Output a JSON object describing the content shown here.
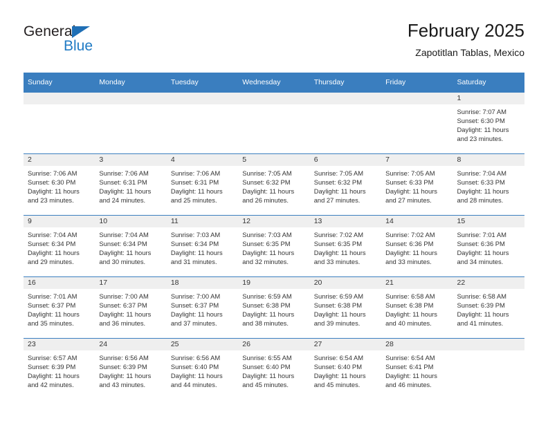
{
  "brand": {
    "name_part1": "General",
    "name_part2": "Blue",
    "triangle_color": "#1f6fb5",
    "blue_color": "#1f7ac4"
  },
  "header": {
    "title": "February 2025",
    "subtitle": "Zapotitlan Tablas, Mexico"
  },
  "theme": {
    "header_bg": "#3a7ebf",
    "daynum_bg": "#efefef",
    "row_border": "#3a7ebf"
  },
  "weekdays": [
    "Sunday",
    "Monday",
    "Tuesday",
    "Wednesday",
    "Thursday",
    "Friday",
    "Saturday"
  ],
  "weeks": [
    [
      {
        "day": "",
        "empty": true,
        "sunrise": "",
        "sunset": "",
        "daylight1": "",
        "daylight2": ""
      },
      {
        "day": "",
        "empty": true,
        "sunrise": "",
        "sunset": "",
        "daylight1": "",
        "daylight2": ""
      },
      {
        "day": "",
        "empty": true,
        "sunrise": "",
        "sunset": "",
        "daylight1": "",
        "daylight2": ""
      },
      {
        "day": "",
        "empty": true,
        "sunrise": "",
        "sunset": "",
        "daylight1": "",
        "daylight2": ""
      },
      {
        "day": "",
        "empty": true,
        "sunrise": "",
        "sunset": "",
        "daylight1": "",
        "daylight2": ""
      },
      {
        "day": "",
        "empty": true,
        "sunrise": "",
        "sunset": "",
        "daylight1": "",
        "daylight2": ""
      },
      {
        "day": "1",
        "empty": false,
        "sunrise": "Sunrise: 7:07 AM",
        "sunset": "Sunset: 6:30 PM",
        "daylight1": "Daylight: 11 hours",
        "daylight2": "and 23 minutes."
      }
    ],
    [
      {
        "day": "2",
        "empty": false,
        "sunrise": "Sunrise: 7:06 AM",
        "sunset": "Sunset: 6:30 PM",
        "daylight1": "Daylight: 11 hours",
        "daylight2": "and 23 minutes."
      },
      {
        "day": "3",
        "empty": false,
        "sunrise": "Sunrise: 7:06 AM",
        "sunset": "Sunset: 6:31 PM",
        "daylight1": "Daylight: 11 hours",
        "daylight2": "and 24 minutes."
      },
      {
        "day": "4",
        "empty": false,
        "sunrise": "Sunrise: 7:06 AM",
        "sunset": "Sunset: 6:31 PM",
        "daylight1": "Daylight: 11 hours",
        "daylight2": "and 25 minutes."
      },
      {
        "day": "5",
        "empty": false,
        "sunrise": "Sunrise: 7:05 AM",
        "sunset": "Sunset: 6:32 PM",
        "daylight1": "Daylight: 11 hours",
        "daylight2": "and 26 minutes."
      },
      {
        "day": "6",
        "empty": false,
        "sunrise": "Sunrise: 7:05 AM",
        "sunset": "Sunset: 6:32 PM",
        "daylight1": "Daylight: 11 hours",
        "daylight2": "and 27 minutes."
      },
      {
        "day": "7",
        "empty": false,
        "sunrise": "Sunrise: 7:05 AM",
        "sunset": "Sunset: 6:33 PM",
        "daylight1": "Daylight: 11 hours",
        "daylight2": "and 27 minutes."
      },
      {
        "day": "8",
        "empty": false,
        "sunrise": "Sunrise: 7:04 AM",
        "sunset": "Sunset: 6:33 PM",
        "daylight1": "Daylight: 11 hours",
        "daylight2": "and 28 minutes."
      }
    ],
    [
      {
        "day": "9",
        "empty": false,
        "sunrise": "Sunrise: 7:04 AM",
        "sunset": "Sunset: 6:34 PM",
        "daylight1": "Daylight: 11 hours",
        "daylight2": "and 29 minutes."
      },
      {
        "day": "10",
        "empty": false,
        "sunrise": "Sunrise: 7:04 AM",
        "sunset": "Sunset: 6:34 PM",
        "daylight1": "Daylight: 11 hours",
        "daylight2": "and 30 minutes."
      },
      {
        "day": "11",
        "empty": false,
        "sunrise": "Sunrise: 7:03 AM",
        "sunset": "Sunset: 6:34 PM",
        "daylight1": "Daylight: 11 hours",
        "daylight2": "and 31 minutes."
      },
      {
        "day": "12",
        "empty": false,
        "sunrise": "Sunrise: 7:03 AM",
        "sunset": "Sunset: 6:35 PM",
        "daylight1": "Daylight: 11 hours",
        "daylight2": "and 32 minutes."
      },
      {
        "day": "13",
        "empty": false,
        "sunrise": "Sunrise: 7:02 AM",
        "sunset": "Sunset: 6:35 PM",
        "daylight1": "Daylight: 11 hours",
        "daylight2": "and 33 minutes."
      },
      {
        "day": "14",
        "empty": false,
        "sunrise": "Sunrise: 7:02 AM",
        "sunset": "Sunset: 6:36 PM",
        "daylight1": "Daylight: 11 hours",
        "daylight2": "and 33 minutes."
      },
      {
        "day": "15",
        "empty": false,
        "sunrise": "Sunrise: 7:01 AM",
        "sunset": "Sunset: 6:36 PM",
        "daylight1": "Daylight: 11 hours",
        "daylight2": "and 34 minutes."
      }
    ],
    [
      {
        "day": "16",
        "empty": false,
        "sunrise": "Sunrise: 7:01 AM",
        "sunset": "Sunset: 6:37 PM",
        "daylight1": "Daylight: 11 hours",
        "daylight2": "and 35 minutes."
      },
      {
        "day": "17",
        "empty": false,
        "sunrise": "Sunrise: 7:00 AM",
        "sunset": "Sunset: 6:37 PM",
        "daylight1": "Daylight: 11 hours",
        "daylight2": "and 36 minutes."
      },
      {
        "day": "18",
        "empty": false,
        "sunrise": "Sunrise: 7:00 AM",
        "sunset": "Sunset: 6:37 PM",
        "daylight1": "Daylight: 11 hours",
        "daylight2": "and 37 minutes."
      },
      {
        "day": "19",
        "empty": false,
        "sunrise": "Sunrise: 6:59 AM",
        "sunset": "Sunset: 6:38 PM",
        "daylight1": "Daylight: 11 hours",
        "daylight2": "and 38 minutes."
      },
      {
        "day": "20",
        "empty": false,
        "sunrise": "Sunrise: 6:59 AM",
        "sunset": "Sunset: 6:38 PM",
        "daylight1": "Daylight: 11 hours",
        "daylight2": "and 39 minutes."
      },
      {
        "day": "21",
        "empty": false,
        "sunrise": "Sunrise: 6:58 AM",
        "sunset": "Sunset: 6:38 PM",
        "daylight1": "Daylight: 11 hours",
        "daylight2": "and 40 minutes."
      },
      {
        "day": "22",
        "empty": false,
        "sunrise": "Sunrise: 6:58 AM",
        "sunset": "Sunset: 6:39 PM",
        "daylight1": "Daylight: 11 hours",
        "daylight2": "and 41 minutes."
      }
    ],
    [
      {
        "day": "23",
        "empty": false,
        "sunrise": "Sunrise: 6:57 AM",
        "sunset": "Sunset: 6:39 PM",
        "daylight1": "Daylight: 11 hours",
        "daylight2": "and 42 minutes."
      },
      {
        "day": "24",
        "empty": false,
        "sunrise": "Sunrise: 6:56 AM",
        "sunset": "Sunset: 6:39 PM",
        "daylight1": "Daylight: 11 hours",
        "daylight2": "and 43 minutes."
      },
      {
        "day": "25",
        "empty": false,
        "sunrise": "Sunrise: 6:56 AM",
        "sunset": "Sunset: 6:40 PM",
        "daylight1": "Daylight: 11 hours",
        "daylight2": "and 44 minutes."
      },
      {
        "day": "26",
        "empty": false,
        "sunrise": "Sunrise: 6:55 AM",
        "sunset": "Sunset: 6:40 PM",
        "daylight1": "Daylight: 11 hours",
        "daylight2": "and 45 minutes."
      },
      {
        "day": "27",
        "empty": false,
        "sunrise": "Sunrise: 6:54 AM",
        "sunset": "Sunset: 6:40 PM",
        "daylight1": "Daylight: 11 hours",
        "daylight2": "and 45 minutes."
      },
      {
        "day": "28",
        "empty": false,
        "sunrise": "Sunrise: 6:54 AM",
        "sunset": "Sunset: 6:41 PM",
        "daylight1": "Daylight: 11 hours",
        "daylight2": "and 46 minutes."
      },
      {
        "day": "",
        "empty": true,
        "sunrise": "",
        "sunset": "",
        "daylight1": "",
        "daylight2": ""
      }
    ]
  ]
}
